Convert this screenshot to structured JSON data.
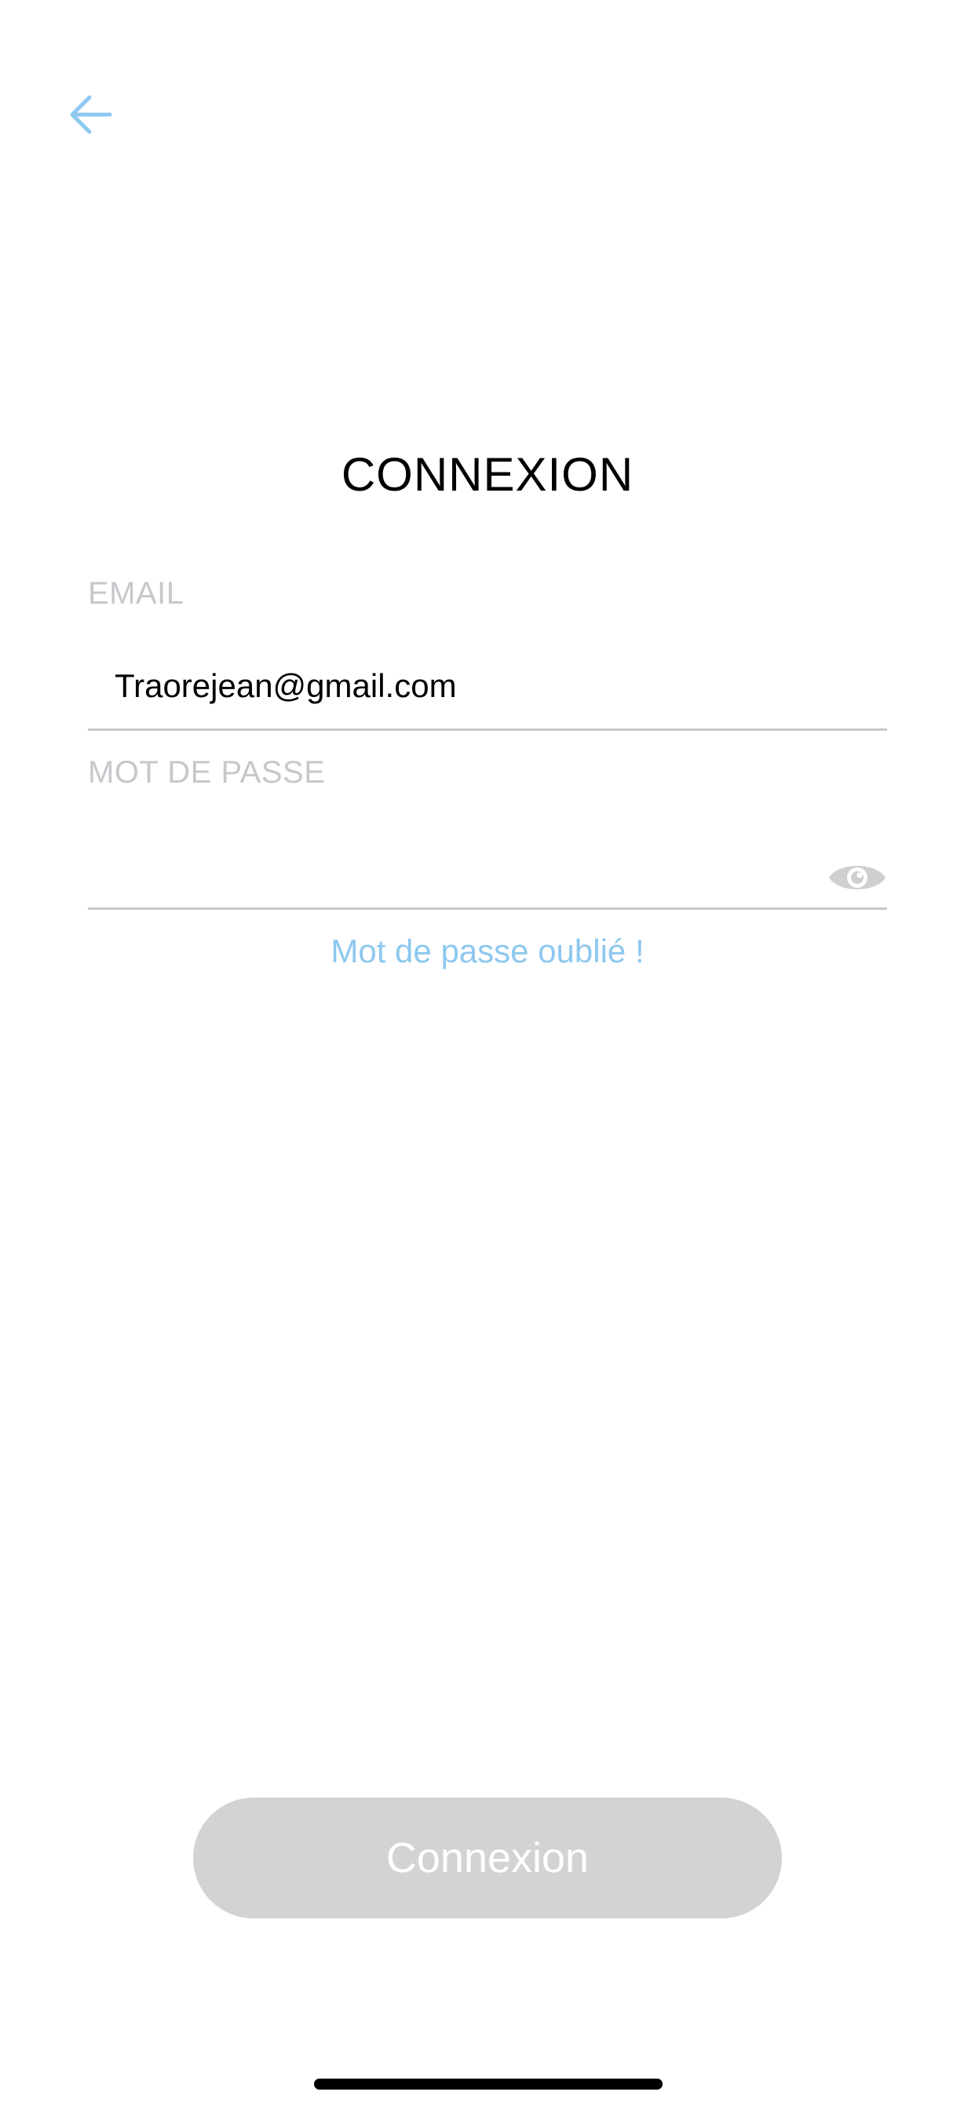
{
  "header": {
    "back_icon": "arrow-left-icon"
  },
  "title": "CONNEXION",
  "email": {
    "label": "EMAIL",
    "value": "Traorejean@gmail.com"
  },
  "password": {
    "label": "MOT DE PASSE",
    "value": "",
    "toggle_icon": "eye-icon"
  },
  "forgot_password": "Mot de passe oublié !",
  "submit": {
    "label": "Connexion",
    "enabled": false
  },
  "colors": {
    "accent": "#8ec8ef",
    "label": "#c7c7cc",
    "divider": "#c8c8c8",
    "button_disabled_bg": "#d3d3d3",
    "button_text": "#ffffff"
  }
}
